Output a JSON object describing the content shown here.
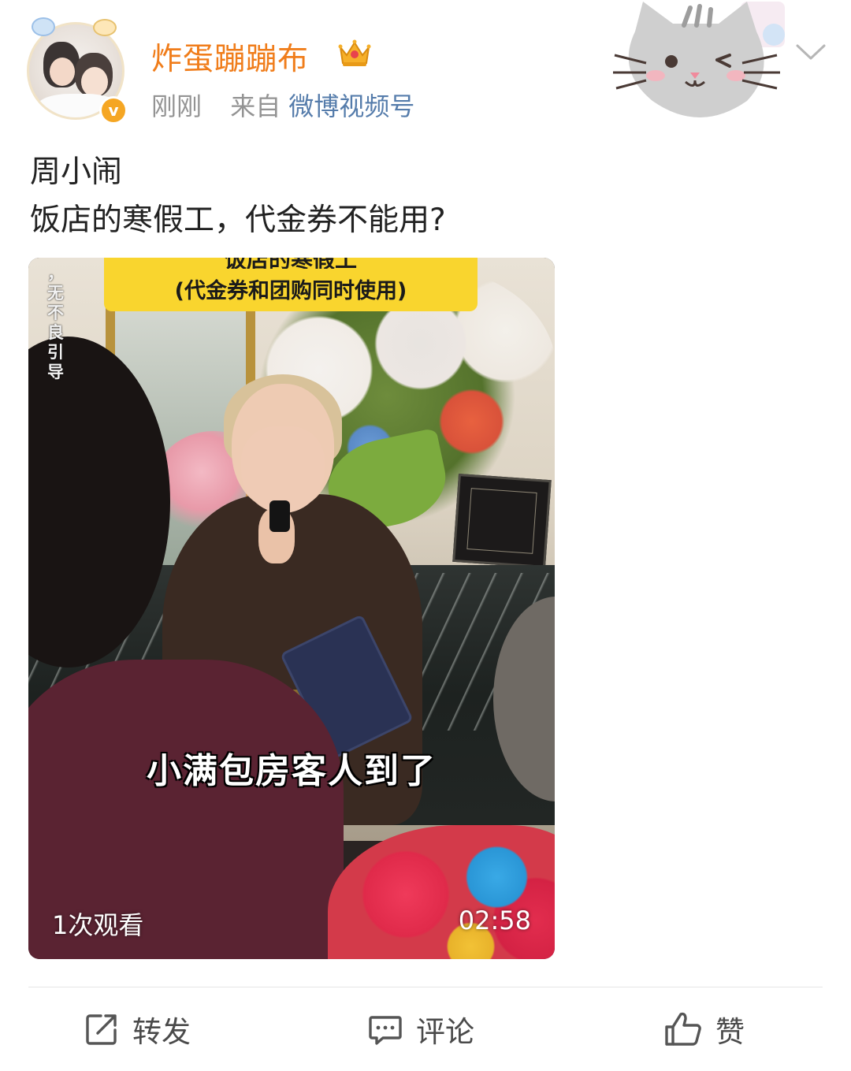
{
  "post": {
    "author": {
      "name": "炸蛋蹦蹦布",
      "verified_mark": "v",
      "badge_icon": "crown-icon"
    },
    "meta": {
      "time": "刚刚",
      "source_prefix": "来自",
      "source_name": "微博视频号"
    },
    "text": {
      "line1": "周小闹",
      "line2": "饭店的寒假工，代金券不能用?"
    },
    "video": {
      "caption_top": "饭店的寒假工",
      "caption_sub": "(代金券和团购同时使用)",
      "side_note": "，无不良引导",
      "subtitle": "小满包房客人到了",
      "views": "1次观看",
      "duration": "02:58"
    }
  },
  "actions": {
    "forward_label": "转发",
    "comment_label": "评论",
    "like_label": "赞"
  },
  "colors": {
    "username": "#f07d1b",
    "link": "#557cab",
    "caption_bar": "#f9d52e",
    "verified_badge": "#f5a623"
  }
}
